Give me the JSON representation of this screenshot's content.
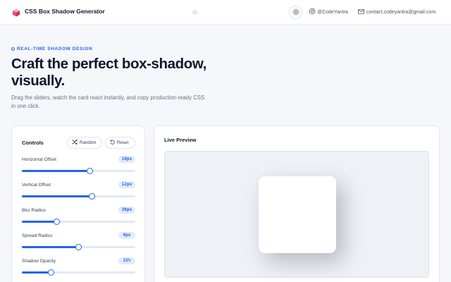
{
  "header": {
    "app_title": "CSS Box Shadow Generator",
    "instagram": "@CodeYantra",
    "email": "contact.codeyantra@gmail.com",
    "icons": {
      "logo": "cube-logo-icon",
      "theme": "sun-icon",
      "instagram": "instagram-icon",
      "email": "mail-icon"
    }
  },
  "hero": {
    "eyebrow": "REAL-TIME SHADOW DESIGN",
    "title": "Craft the perfect box-shadow, visually.",
    "subtitle": "Drag the sliders, watch the card react instantly, and copy production-ready CSS in one click."
  },
  "controls": {
    "title": "Controls",
    "random_label": "Random",
    "reset_label": "Reset",
    "sliders": [
      {
        "label": "Horizontal Offset",
        "value": "10px",
        "fraction": 0.6
      },
      {
        "label": "Vertical Offset",
        "value": "12px",
        "fraction": 0.615
      },
      {
        "label": "Blur Radius",
        "value": "30px",
        "fraction": 0.31
      },
      {
        "label": "Spread Radius",
        "value": "0px",
        "fraction": 0.5
      },
      {
        "label": "Shadow Opacity",
        "value": "25%",
        "fraction": 0.26
      }
    ]
  },
  "preview": {
    "title": "Live Preview"
  },
  "shadow": {
    "x": 10,
    "y": 12,
    "blur": 30,
    "spread": 0,
    "opacity": 0.25
  },
  "colors": {
    "accent": "#2563eb",
    "badge_bg": "#e0eaff",
    "stage_bg": "#eef1f6",
    "page_bg": "#f5f7fa"
  }
}
